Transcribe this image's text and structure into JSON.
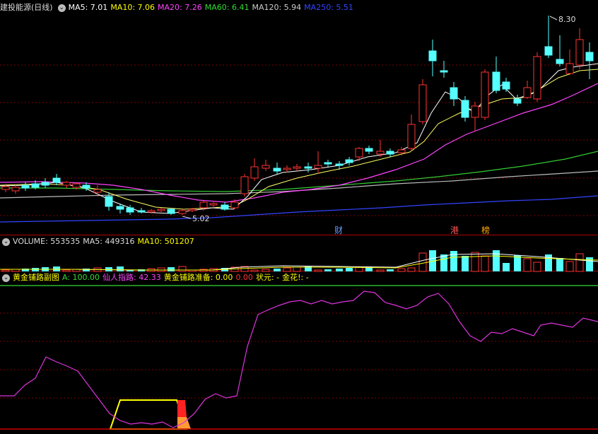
{
  "main": {
    "title": "建投能源(日线)",
    "indicators": [
      {
        "label": "MA5: 7.01",
        "color": "#ffffff"
      },
      {
        "label": "MA10: 7.06",
        "color": "#ffff00"
      },
      {
        "label": "MA20: 7.26",
        "color": "#ff44ff"
      },
      {
        "label": "MA60: 6.41",
        "color": "#33dd33"
      },
      {
        "label": "MA120: 5.94",
        "color": "#cccccc"
      },
      {
        "label": "MA250: 5.51",
        "color": "#3344ff"
      }
    ],
    "high_label": "8.30",
    "low_label": "5.02",
    "markers": [
      {
        "text": "财",
        "color": "#6699ff"
      },
      {
        "text": "港",
        "color": "#ff5555"
      },
      {
        "text": "榜",
        "color": "#ffaa00"
      }
    ]
  },
  "volume": {
    "indicators": [
      {
        "label": "VOLUME: 553535",
        "color": "#dddddd"
      },
      {
        "label": "MA5: 449316",
        "color": "#dddddd"
      },
      {
        "label": "MA10: 501207",
        "color": "#ffff00"
      }
    ]
  },
  "sub": {
    "title": "黄金铺路副图",
    "indicators": [
      {
        "label": "A: 100.00",
        "color": "#33dd33"
      },
      {
        "label": "仙人指路: 42.33",
        "color": "#ff44ff"
      },
      {
        "label": "黄金铺路准备: 0.00",
        "color": "#ffff00"
      },
      {
        "label": "0.00",
        "color": "#ff3333"
      },
      {
        "label": "状元: -",
        "color": "#ffff00"
      },
      {
        "label": "金花!: -",
        "color": "#ffff00"
      }
    ]
  },
  "colors": {
    "up": "#ff3333",
    "down": "#55ffff",
    "grid": "#7a0000"
  }
}
